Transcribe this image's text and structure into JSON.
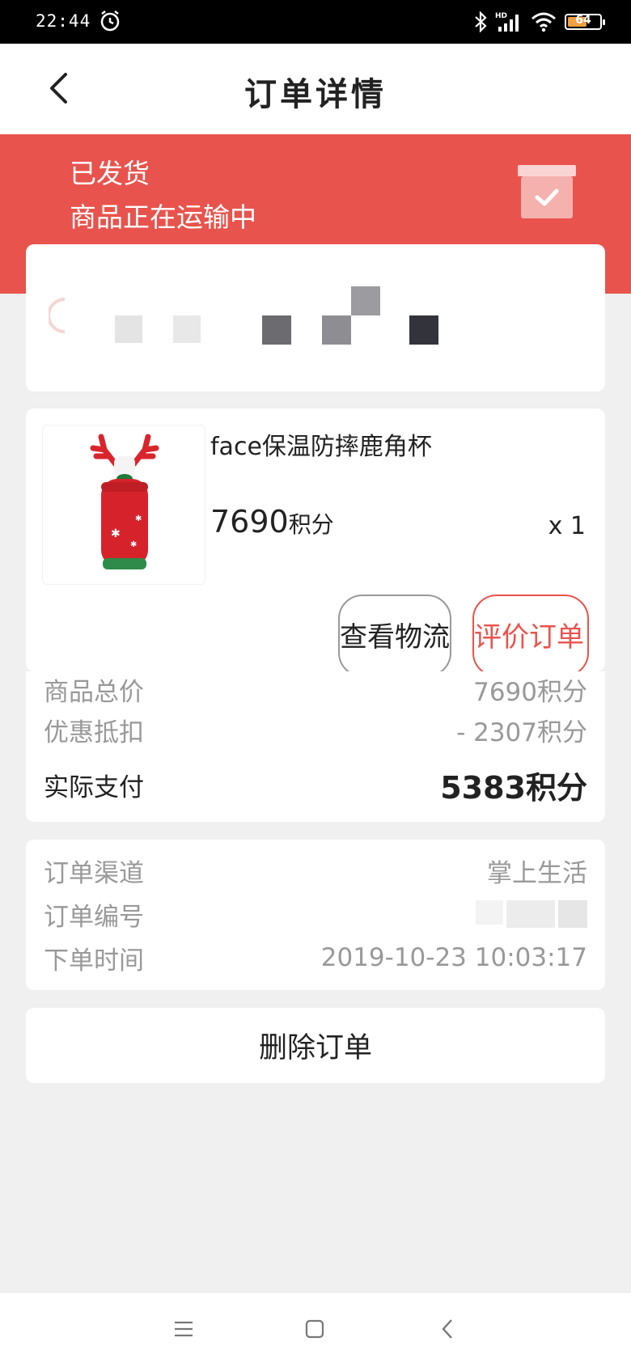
{
  "status_bar": {
    "time": "22:44",
    "battery": "64",
    "battery_level": 0.64,
    "icons": [
      "alarm-icon",
      "bluetooth-icon",
      "hd-signal-icon",
      "wifi-icon",
      "battery-icon"
    ]
  },
  "nav": {
    "title": "订单详情",
    "back_icon": "back-arrow-icon"
  },
  "banner": {
    "status": "已发货",
    "subtitle": "商品正在运输中",
    "icon": "package-check-icon",
    "color": "#e9534d"
  },
  "product": {
    "name": "face保温防摔鹿角杯",
    "price": "7690",
    "price_unit": "积分",
    "quantity": "x 1",
    "buttons": {
      "logistics": "查看物流",
      "review": "评价订单"
    }
  },
  "summary": {
    "rows": [
      {
        "label": "商品总价",
        "value": "7690积分"
      },
      {
        "label": "优惠抵扣",
        "value": "- 2307积分"
      },
      {
        "label": "实际支付",
        "value": "5383积分"
      }
    ]
  },
  "order_info": {
    "rows": [
      {
        "label": "订单渠道",
        "value": "掌上生活"
      },
      {
        "label": "订单编号",
        "value": ""
      },
      {
        "label": "下单时间",
        "value": "2019-10-23 10:03:17"
      }
    ]
  },
  "actions": {
    "delete": "删除订单"
  },
  "system_nav": {
    "icons": [
      "menu-icon",
      "home-icon",
      "back-icon"
    ]
  }
}
